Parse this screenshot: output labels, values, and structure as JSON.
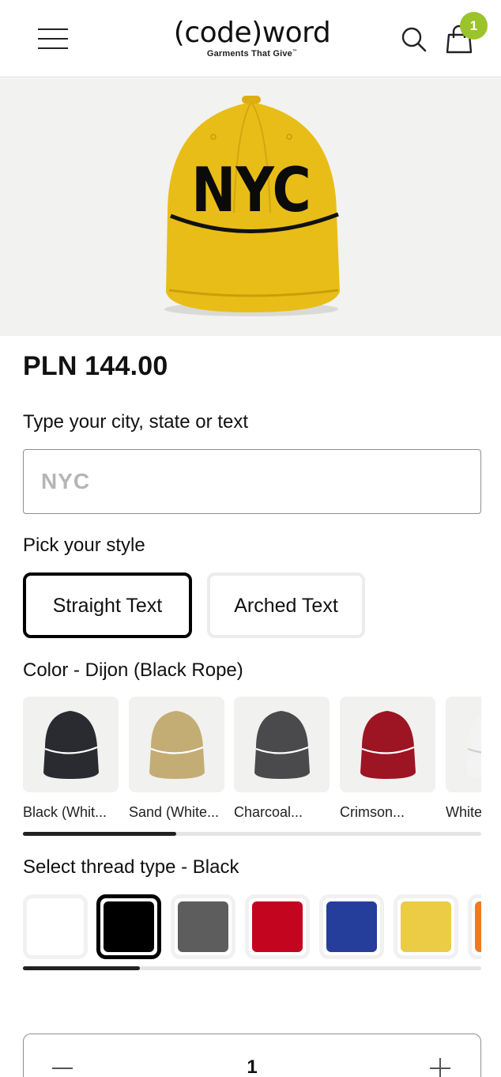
{
  "header": {
    "logo": "(code)word",
    "tagline": "Garments That Give",
    "tagline_mark": "™",
    "cart_count": "1",
    "icons": {
      "menu": "hamburger-menu-icon",
      "search": "search-icon",
      "cart": "shopping-bag-icon"
    },
    "badge_color": "#9bc32a"
  },
  "hero": {
    "product": "yellow rope cap",
    "hat_text": "NYC",
    "hat_color": "#e9bd17",
    "rope_color": "#111111"
  },
  "product": {
    "price": "PLN 144.00"
  },
  "custom_text": {
    "label": "Type your city, state or text",
    "placeholder": "NYC",
    "value": ""
  },
  "style": {
    "label": "Pick your style",
    "options": [
      "Straight Text",
      "Arched Text"
    ],
    "selected": "Straight Text"
  },
  "color": {
    "label": "Color - Dijon (Black Rope)",
    "options": [
      {
        "name": "Black (Whit...",
        "hat": "#2a2b30",
        "rope": "#ffffff"
      },
      {
        "name": "Sand (White...",
        "hat": "#c4ad74",
        "rope": "#ffffff"
      },
      {
        "name": "Charcoal...",
        "hat": "#4a4a4d",
        "rope": "#ffffff"
      },
      {
        "name": "Crimson...",
        "hat": "#9d1423",
        "rope": "#ffffff"
      },
      {
        "name": "White",
        "hat": "#f3f3f3",
        "rope": "#cfcfcf"
      }
    ],
    "scroll_fraction": 0.335
  },
  "thread": {
    "label": "Select thread type - Black",
    "options": [
      {
        "name": "White",
        "color": "#ffffff"
      },
      {
        "name": "Black",
        "color": "#000000"
      },
      {
        "name": "Gray",
        "color": "#5d5d5d"
      },
      {
        "name": "Red",
        "color": "#c4051f"
      },
      {
        "name": "Blue",
        "color": "#253e9b"
      },
      {
        "name": "Yellow",
        "color": "#eccb45"
      },
      {
        "name": "Orange",
        "color": "#f27a1a"
      }
    ],
    "selected": "Black",
    "scroll_fraction": 0.255
  },
  "quantity": {
    "value": "1"
  }
}
